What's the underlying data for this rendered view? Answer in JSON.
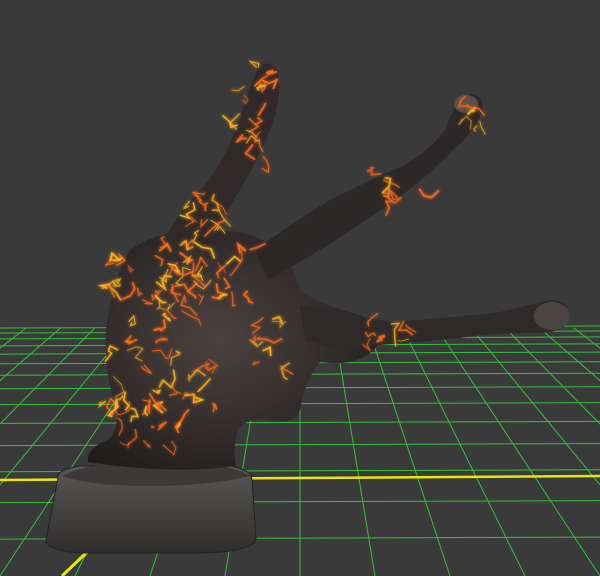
{
  "viewport": {
    "background_color": "#3a3a3a",
    "grid_color": "#35c03a",
    "axis_x_color": "#e8e800",
    "axis_z_color": "#e8e800"
  },
  "model": {
    "name": "lava-hand-sculpture",
    "base_color": "#2e2b2a",
    "crack_glow_color": "#ff6a1a",
    "crack_hot_color": "#ffb020",
    "pedestal_color": "#4a4846"
  }
}
